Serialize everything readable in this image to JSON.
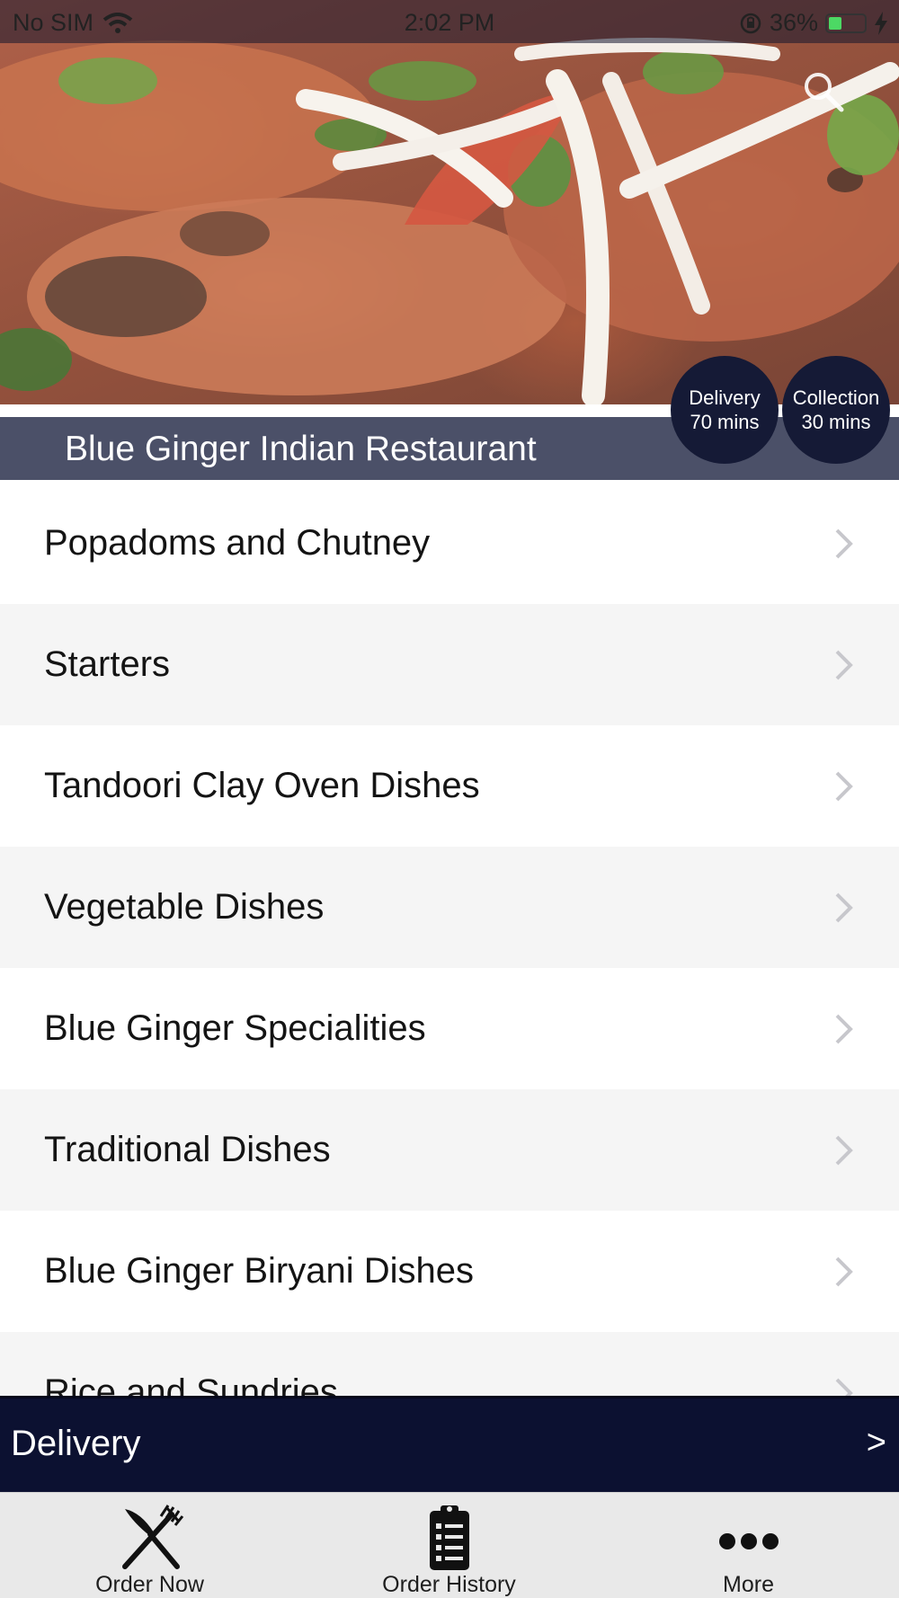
{
  "status_bar": {
    "carrier": "No SIM",
    "time": "2:02 PM",
    "battery": "36%",
    "battery_level": 0.36
  },
  "header": {
    "restaurant_name": "Blue Ginger Indian Restaurant",
    "search_icon": "search-icon"
  },
  "badges": {
    "delivery": {
      "title": "Delivery",
      "time": "70 mins"
    },
    "collection": {
      "title": "Collection",
      "time": "30 mins"
    }
  },
  "categories": [
    {
      "label": "Popadoms and Chutney"
    },
    {
      "label": "Starters"
    },
    {
      "label": "Tandoori Clay Oven Dishes"
    },
    {
      "label": "Vegetable Dishes"
    },
    {
      "label": "Blue Ginger Specialities"
    },
    {
      "label": "Traditional Dishes"
    },
    {
      "label": "Blue Ginger Biryani Dishes"
    },
    {
      "label": "Rice and Sundries"
    }
  ],
  "delivery_bar": {
    "label": "Delivery",
    "arrow": ">"
  },
  "tabbar": {
    "items": [
      {
        "label": "Order Now",
        "icon": "fork-knife-icon"
      },
      {
        "label": "Order History",
        "icon": "clipboard-list-icon"
      },
      {
        "label": "More",
        "icon": "more-dots-icon"
      }
    ]
  },
  "colors": {
    "name_bar": "#4b5068",
    "badge": "#151a36",
    "delivery_bar": "#0c1131",
    "tabbar": "#e9e9e9",
    "row_alt": "#f5f5f5",
    "chevron": "#c7c7cc"
  }
}
